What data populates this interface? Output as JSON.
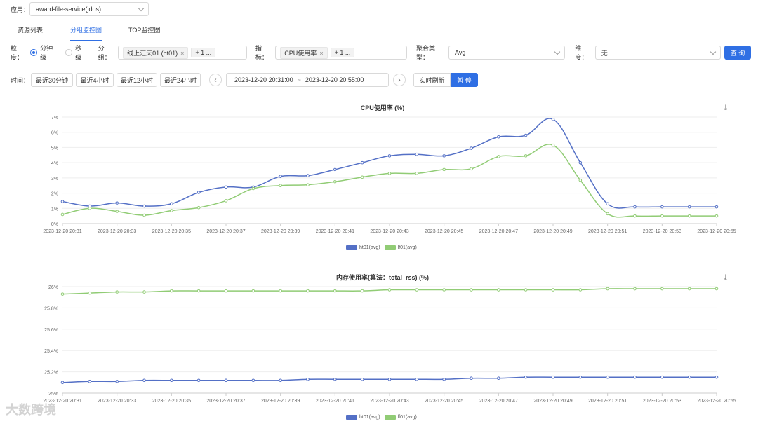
{
  "app": {
    "label": "应用：",
    "value": "award-file-service(jdos)"
  },
  "tabs": [
    {
      "label": "资源列表",
      "active": false
    },
    {
      "label": "分组监控图",
      "active": true
    },
    {
      "label": "TOP监控图",
      "active": false
    }
  ],
  "filters": {
    "granularity_label": "粒度：",
    "granularity_options": [
      "分钟级",
      "秒级"
    ],
    "group_label": "分组：",
    "group_tag": "线上汇天01 (ht01)",
    "group_more": "+ 1 ...",
    "metric_label": "指标：",
    "metric_tag": "CPU使用率",
    "metric_more": "+ 1 ...",
    "agg_label": "聚合类型：",
    "agg_value": "Avg",
    "dim_label": "维度：",
    "dim_value": "无",
    "query_button": "查 询"
  },
  "time": {
    "label": "时间：",
    "quick": [
      "最近30分钟",
      "最近4小时",
      "最近12小时",
      "最近24小时"
    ],
    "range_start": "2023-12-20 20:31:00",
    "range_sep": "~",
    "range_end": "2023-12-20 20:55:00",
    "realtime_button": "实时刷新",
    "pause_button": "暂 停"
  },
  "icons": {
    "download": "download-icon",
    "prev": "chevron-left-icon",
    "next": "chevron-right-icon"
  },
  "colors": {
    "accent": "#2f6fe4",
    "ht01": "#5470c6",
    "lf01": "#91cc75"
  },
  "watermark": "大数跨境",
  "chart_data": [
    {
      "type": "line",
      "title": "CPU使用率 (%)",
      "ylim": [
        0,
        7
      ],
      "yticks": [
        "0%",
        "1%",
        "2%",
        "3%",
        "4%",
        "5%",
        "6%",
        "7%"
      ],
      "xticks": [
        "2023-12-20 20:31",
        "2023-12-20 20:33",
        "2023-12-20 20:35",
        "2023-12-20 20:37",
        "2023-12-20 20:39",
        "2023-12-20 20:41",
        "2023-12-20 20:43",
        "2023-12-20 20:45",
        "2023-12-20 20:47",
        "2023-12-20 20:49",
        "2023-12-20 20:51",
        "2023-12-20 20:53",
        "2023-12-20 20:55"
      ],
      "legend_position": "bottom",
      "series": [
        {
          "name": "ht01(avg)",
          "color": "#5470c6",
          "values": [
            1.45,
            1.15,
            1.35,
            1.15,
            1.3,
            2.05,
            2.4,
            2.4,
            3.1,
            3.15,
            3.55,
            4.0,
            4.45,
            4.55,
            4.45,
            4.95,
            5.7,
            5.8,
            6.85,
            4.0,
            1.3,
            1.1,
            1.1,
            1.1,
            1.1
          ]
        },
        {
          "name": "lf01(avg)",
          "color": "#91cc75",
          "values": [
            0.6,
            1.0,
            0.8,
            0.55,
            0.85,
            1.05,
            1.5,
            2.3,
            2.5,
            2.55,
            2.75,
            3.05,
            3.3,
            3.3,
            3.55,
            3.6,
            4.4,
            4.45,
            5.15,
            2.85,
            0.65,
            0.5,
            0.5,
            0.5,
            0.5
          ]
        }
      ]
    },
    {
      "type": "line",
      "title": "内存使用率(算法：total_rss) (%)",
      "ylim": [
        25,
        26
      ],
      "yticks": [
        "25%",
        "25.2%",
        "25.4%",
        "25.6%",
        "25.8%",
        "26%"
      ],
      "xticks": [
        "2023-12-20 20:31",
        "2023-12-20 20:33",
        "2023-12-20 20:35",
        "2023-12-20 20:37",
        "2023-12-20 20:39",
        "2023-12-20 20:41",
        "2023-12-20 20:43",
        "2023-12-20 20:45",
        "2023-12-20 20:47",
        "2023-12-20 20:49",
        "2023-12-20 20:51",
        "2023-12-20 20:53",
        "2023-12-20 20:55"
      ],
      "legend_position": "bottom",
      "series": [
        {
          "name": "ht01(avg)",
          "color": "#5470c6",
          "values": [
            25.1,
            25.11,
            25.11,
            25.12,
            25.12,
            25.12,
            25.12,
            25.12,
            25.12,
            25.13,
            25.13,
            25.13,
            25.13,
            25.13,
            25.13,
            25.14,
            25.14,
            25.15,
            25.15,
            25.15,
            25.15,
            25.15,
            25.15,
            25.15,
            25.15
          ]
        },
        {
          "name": "lf01(avg)",
          "color": "#91cc75",
          "values": [
            25.93,
            25.94,
            25.95,
            25.95,
            25.96,
            25.96,
            25.96,
            25.96,
            25.96,
            25.96,
            25.96,
            25.96,
            25.97,
            25.97,
            25.97,
            25.97,
            25.97,
            25.97,
            25.97,
            25.97,
            25.98,
            25.98,
            25.98,
            25.98,
            25.98
          ]
        }
      ]
    }
  ]
}
